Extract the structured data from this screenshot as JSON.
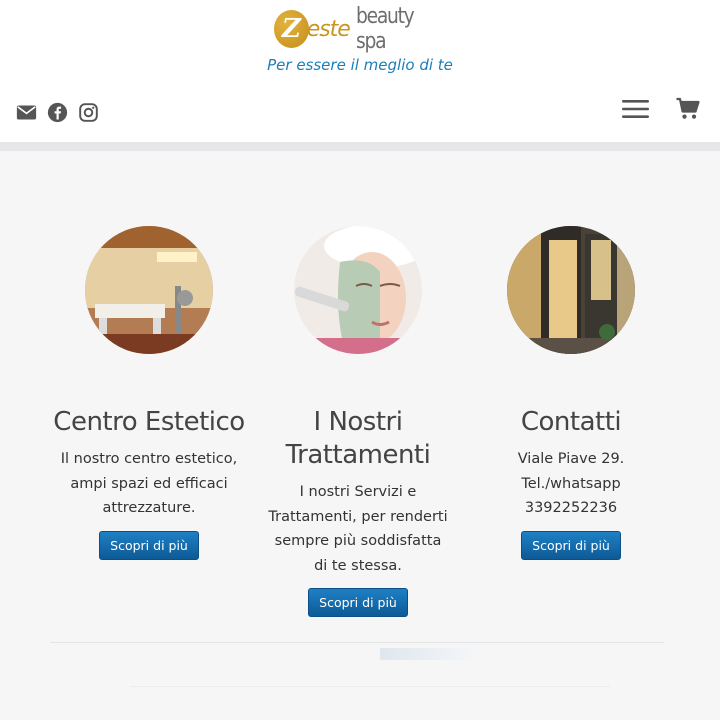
{
  "brand": {
    "logo_letter": "Z",
    "logo_este": "este",
    "logo_rest": "beauty spa",
    "tagline": "Per essere il meglio di te"
  },
  "social_icons": [
    "envelope-icon",
    "facebook-icon",
    "instagram-icon"
  ],
  "header_icons": [
    "hamburger-menu-icon",
    "cart-icon"
  ],
  "colors": {
    "accent_gold": "#c9951e",
    "tagline_blue": "#1a7fb8",
    "button_blue": "#0d5a96"
  },
  "columns": [
    {
      "title": "Centro Estetico",
      "text": "Il nostro centro estetico, ampi spazi ed efficaci attrezzature.",
      "button": "Scopri di più"
    },
    {
      "title": "I Nostri Trattamenti",
      "text": "I nostri Servizi e Trattamenti, per renderti sempre più soddisfatta di te stessa.",
      "button": "Scopri di più"
    },
    {
      "title": "Contatti",
      "text_lines": [
        "Viale Piave 29.",
        "Tel./whatsapp",
        "3392252236"
      ],
      "button": "Scopri di più"
    }
  ]
}
